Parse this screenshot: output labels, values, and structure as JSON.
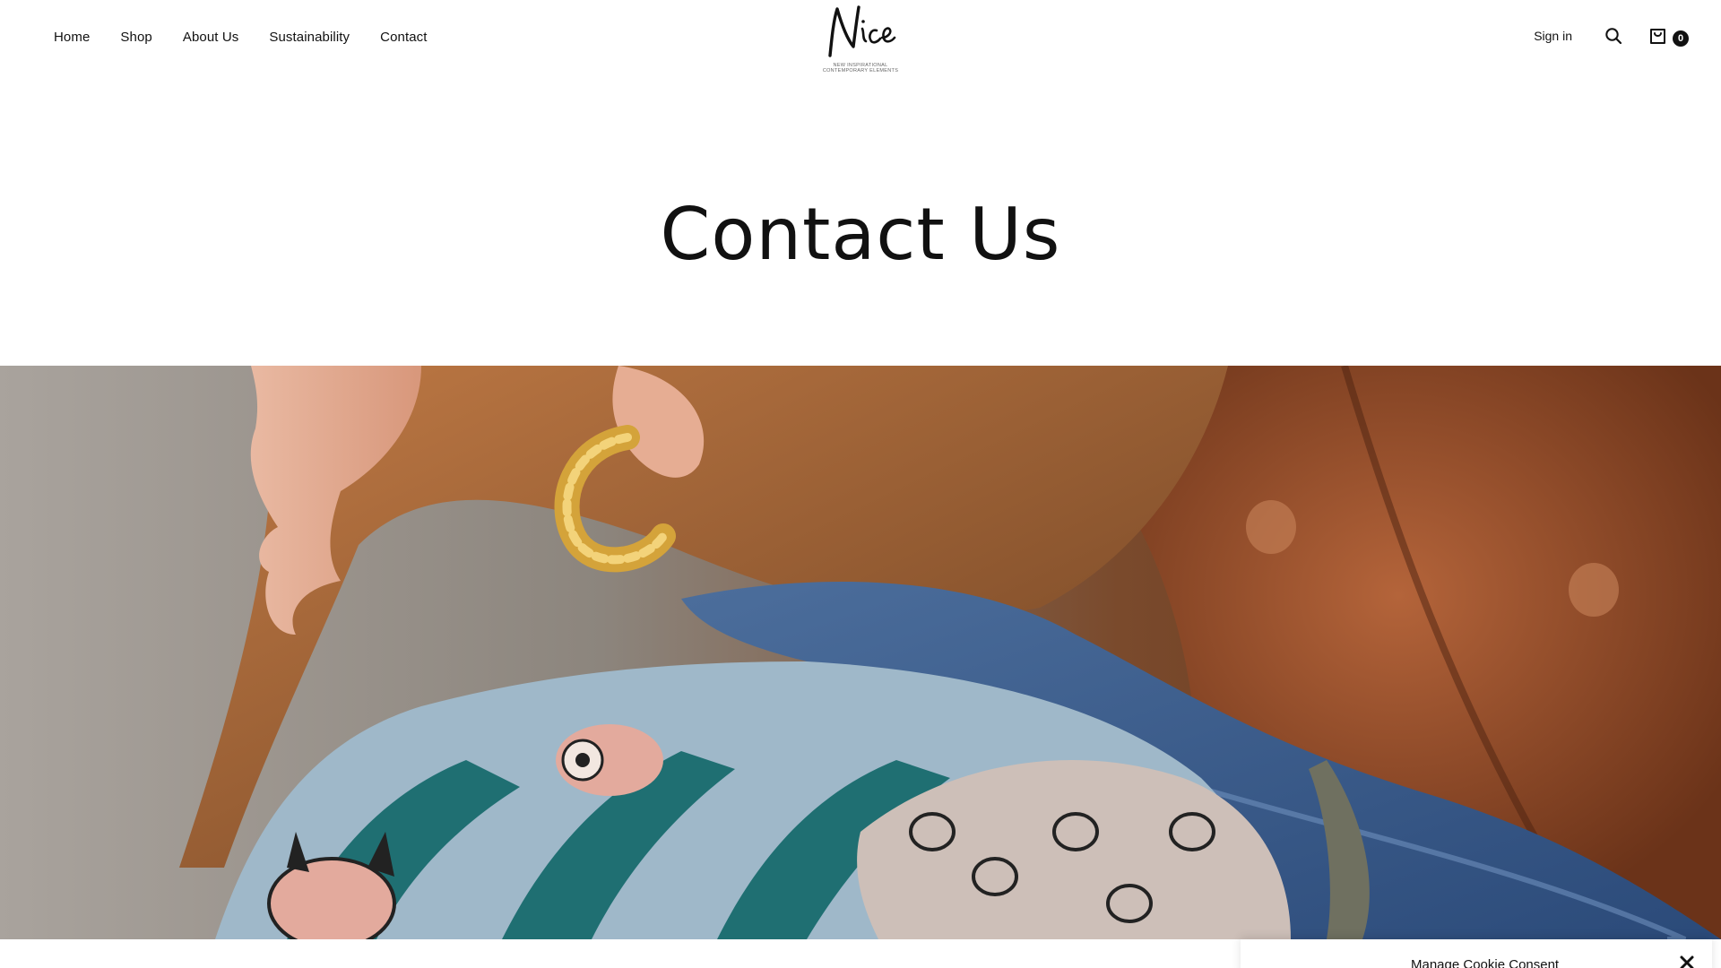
{
  "nav": {
    "items": [
      "Home",
      "Shop",
      "About Us",
      "Sustainability",
      "Contact"
    ]
  },
  "logo": {
    "script_text": "Nice",
    "tagline": "NEW INSPIRATIONAL\nCONTEMPORARY ELEMENTS"
  },
  "header_actions": {
    "sign_in": "Sign in",
    "cart_count": "0",
    "search_icon": "search-icon",
    "cart_icon": "cart-icon"
  },
  "page": {
    "title": "Contact Us"
  },
  "hero": {
    "image": "woman-profile-with-patterned-silk-scarf"
  },
  "cookie_banner": {
    "title": "Manage Cookie Consent",
    "close_icon": "close-icon"
  },
  "colors": {
    "text": "#111111",
    "background": "#ffffff",
    "badge": "#111111"
  }
}
